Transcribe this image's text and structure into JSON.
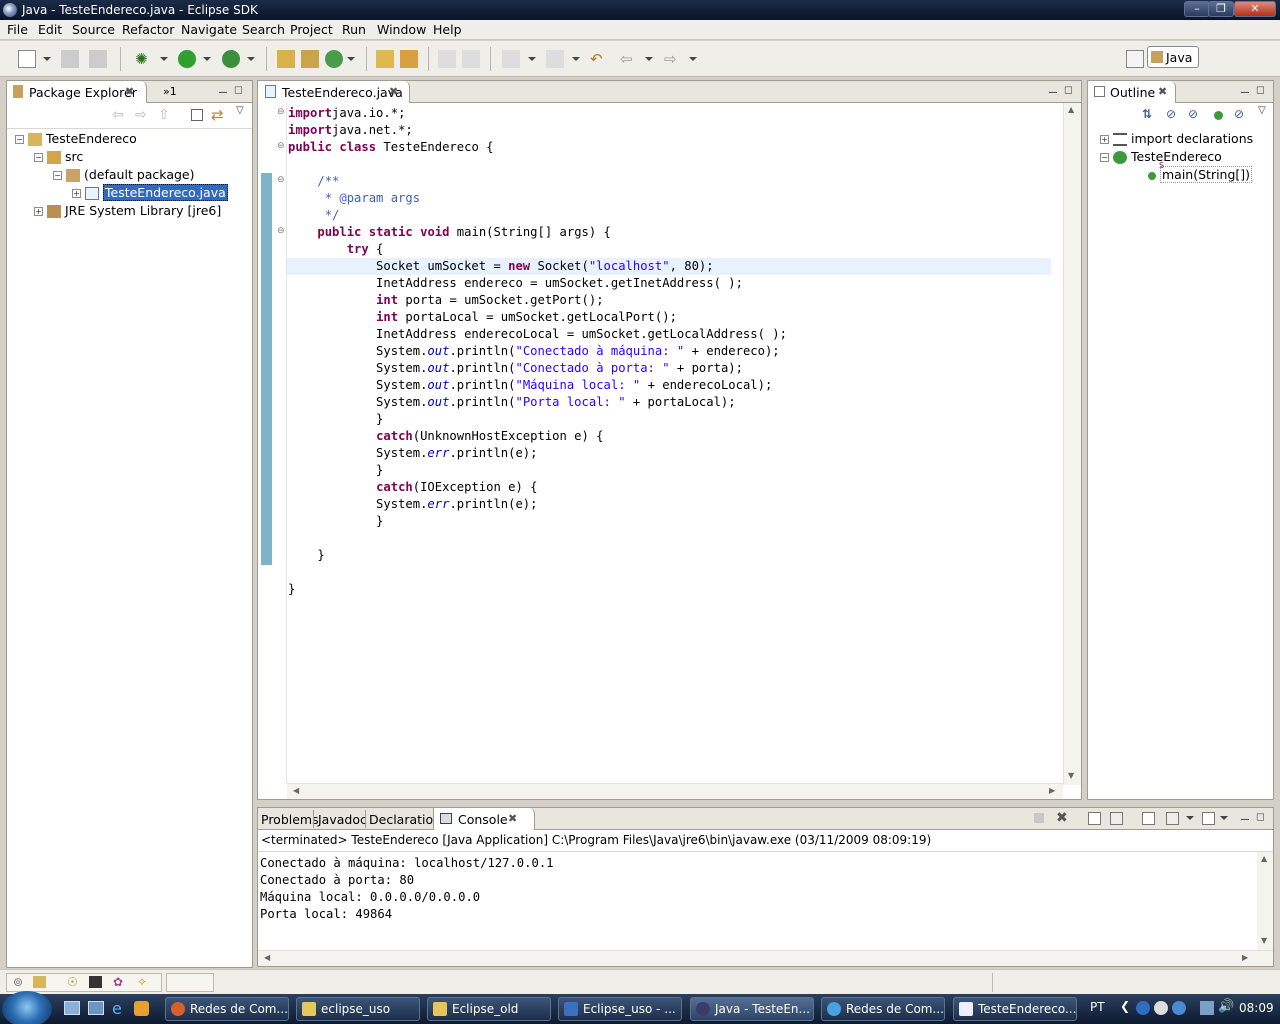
{
  "window": {
    "title": "Java - TesteEndereco.java - Eclipse SDK"
  },
  "menu": [
    "File",
    "Edit",
    "Source",
    "Refactor",
    "Navigate",
    "Search",
    "Project",
    "Run",
    "Window",
    "Help"
  ],
  "perspective": {
    "label": "Java"
  },
  "package_explorer": {
    "tab_label": "Package Explorer",
    "overflow_label": "»1",
    "tree": {
      "project": "TesteEndereco",
      "src": "src",
      "package": "(default package)",
      "file": "TesteEndereco.java",
      "library": "JRE System Library [jre6]"
    }
  },
  "editor": {
    "tab_label": "TesteEndereco.java",
    "code": [
      [
        [
          "kw",
          "import"
        ],
        [
          "",
          "java.io.*;"
        ]
      ],
      [
        [
          "kw",
          "import"
        ],
        [
          "",
          "java.net.*;"
        ]
      ],
      [
        [
          "kw",
          "public"
        ],
        [
          "",
          " "
        ],
        [
          "kw",
          "class"
        ],
        [
          "",
          " TesteEndereco {"
        ]
      ],
      [],
      [
        [
          "",
          "    "
        ],
        [
          "cmt",
          "/**"
        ]
      ],
      [
        [
          "",
          "     "
        ],
        [
          "cmt",
          "* @param args"
        ]
      ],
      [
        [
          "",
          "     "
        ],
        [
          "cmt",
          "*/"
        ]
      ],
      [
        [
          "",
          "    "
        ],
        [
          "kw",
          "public"
        ],
        [
          "",
          " "
        ],
        [
          "kw",
          "static"
        ],
        [
          "",
          " "
        ],
        [
          "kw",
          "void"
        ],
        [
          "",
          " main(String[] args) {"
        ]
      ],
      [
        [
          "",
          "        "
        ],
        [
          "kw",
          "try"
        ],
        [
          "",
          " {"
        ]
      ],
      [
        [
          "",
          "            Socket umSocket = "
        ],
        [
          "kw",
          "new"
        ],
        [
          "",
          " Socket("
        ],
        [
          "str",
          "\"localhost\""
        ],
        [
          "",
          ", 80);"
        ]
      ],
      [
        [
          "",
          "            InetAddress endereco = umSocket.getInetAddress( );"
        ]
      ],
      [
        [
          "",
          "            "
        ],
        [
          "kw",
          "int"
        ],
        [
          "",
          " porta = umSocket.getPort();"
        ]
      ],
      [
        [
          "",
          "            "
        ],
        [
          "kw",
          "int"
        ],
        [
          "",
          " portaLocal = umSocket.getLocalPort();"
        ]
      ],
      [
        [
          "",
          "            InetAddress enderecoLocal = umSocket.getLocalAddress( );"
        ]
      ],
      [
        [
          "",
          "            System."
        ],
        [
          "fld",
          "out"
        ],
        [
          "",
          ".println("
        ],
        [
          "str",
          "\"Conectado à máquina: \""
        ],
        [
          "",
          " + endereco);"
        ]
      ],
      [
        [
          "",
          "            System."
        ],
        [
          "fld",
          "out"
        ],
        [
          "",
          ".println("
        ],
        [
          "str",
          "\"Conectado à porta: \""
        ],
        [
          "",
          " + porta);"
        ]
      ],
      [
        [
          "",
          "            System."
        ],
        [
          "fld",
          "out"
        ],
        [
          "",
          ".println("
        ],
        [
          "str",
          "\"Máquina local: \""
        ],
        [
          "",
          " + enderecoLocal);"
        ]
      ],
      [
        [
          "",
          "            System."
        ],
        [
          "fld",
          "out"
        ],
        [
          "",
          ".println("
        ],
        [
          "str",
          "\"Porta local: \""
        ],
        [
          "",
          " + portaLocal);"
        ]
      ],
      [
        [
          "",
          "            }"
        ]
      ],
      [
        [
          "",
          "            "
        ],
        [
          "kw",
          "catch"
        ],
        [
          "",
          "(UnknownHostException e) {"
        ]
      ],
      [
        [
          "",
          "            System."
        ],
        [
          "fld",
          "err"
        ],
        [
          "",
          ".println(e);"
        ]
      ],
      [
        [
          "",
          "            }"
        ]
      ],
      [
        [
          "",
          "            "
        ],
        [
          "kw",
          "catch"
        ],
        [
          "",
          "(IOException e) {"
        ]
      ],
      [
        [
          "",
          "            System."
        ],
        [
          "fld",
          "err"
        ],
        [
          "",
          ".println(e);"
        ]
      ],
      [
        [
          "",
          "            }"
        ]
      ],
      [],
      [
        [
          "",
          "    }"
        ]
      ],
      [],
      [
        [
          "",
          "}"
        ]
      ]
    ]
  },
  "outline": {
    "tab_label": "Outline",
    "items": {
      "imports": "import declarations",
      "class": "TesteEndereco",
      "method": "main(String[])",
      "modifier": "S"
    }
  },
  "bottom": {
    "tabs": [
      "Problems",
      "Javadoc",
      "Declaration",
      "Console"
    ],
    "status": "<terminated> TesteEndereco [Java Application] C:\\Program Files\\Java\\jre6\\bin\\javaw.exe (03/11/2009 08:09:19)",
    "output": [
      "Conectado à máquina: localhost/127.0.0.1",
      "Conectado à porta: 80",
      "Máquina local: 0.0.0.0/0.0.0.0",
      "Porta local: 49864"
    ]
  },
  "taskbar": {
    "tasks": [
      "Redes de Com...",
      "eclipse_uso",
      "Eclipse_old",
      "Eclipse_uso - ...",
      "Java - TesteEn...",
      "Redes de Com...",
      "TesteEndereco..."
    ],
    "lang": "PT",
    "clock": "08:09"
  },
  "colors": {
    "accent": "#316ac5",
    "keyword": "#7f0055",
    "string": "#2a00ff",
    "comment": "#3f5fbf"
  }
}
